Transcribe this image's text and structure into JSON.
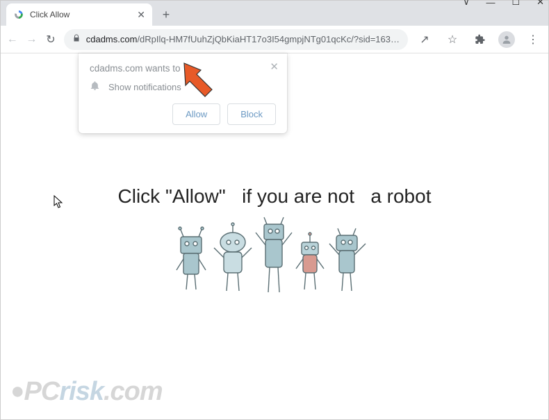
{
  "window": {
    "controls": {
      "dropdown": "∨",
      "minimize": "—",
      "maximize": "☐",
      "close": "✕"
    }
  },
  "tab": {
    "title": "Click Allow",
    "close": "✕",
    "newtab": "+"
  },
  "toolbar": {
    "back": "←",
    "forward": "→",
    "reload": "↻",
    "share": "↗",
    "star": "☆",
    "extensions": "⧩",
    "menu": "⋮"
  },
  "address": {
    "lock_icon": "lock-icon",
    "host": "cdadms.com",
    "path": "/dRpIlq-HM7fUuhZjQbKiaHT17o3I54gmpjNTg01qcKc/?sid=163…"
  },
  "permission": {
    "title": "cdadms.com wants to",
    "option": "Show notifications",
    "allow": "Allow",
    "block": "Block",
    "close": "✕"
  },
  "page": {
    "message_part1": "Click \"Allow\"",
    "message_part2": "if you are not",
    "message_part3": "a robot"
  },
  "watermark": {
    "pc": "PC",
    "risk": "risk",
    "tld": ".com"
  },
  "colors": {
    "arrow": "#e85a28",
    "robot_main": "#a9c6cd",
    "robot_dark": "#6f8e95",
    "robot_pink": "#d89a90"
  }
}
